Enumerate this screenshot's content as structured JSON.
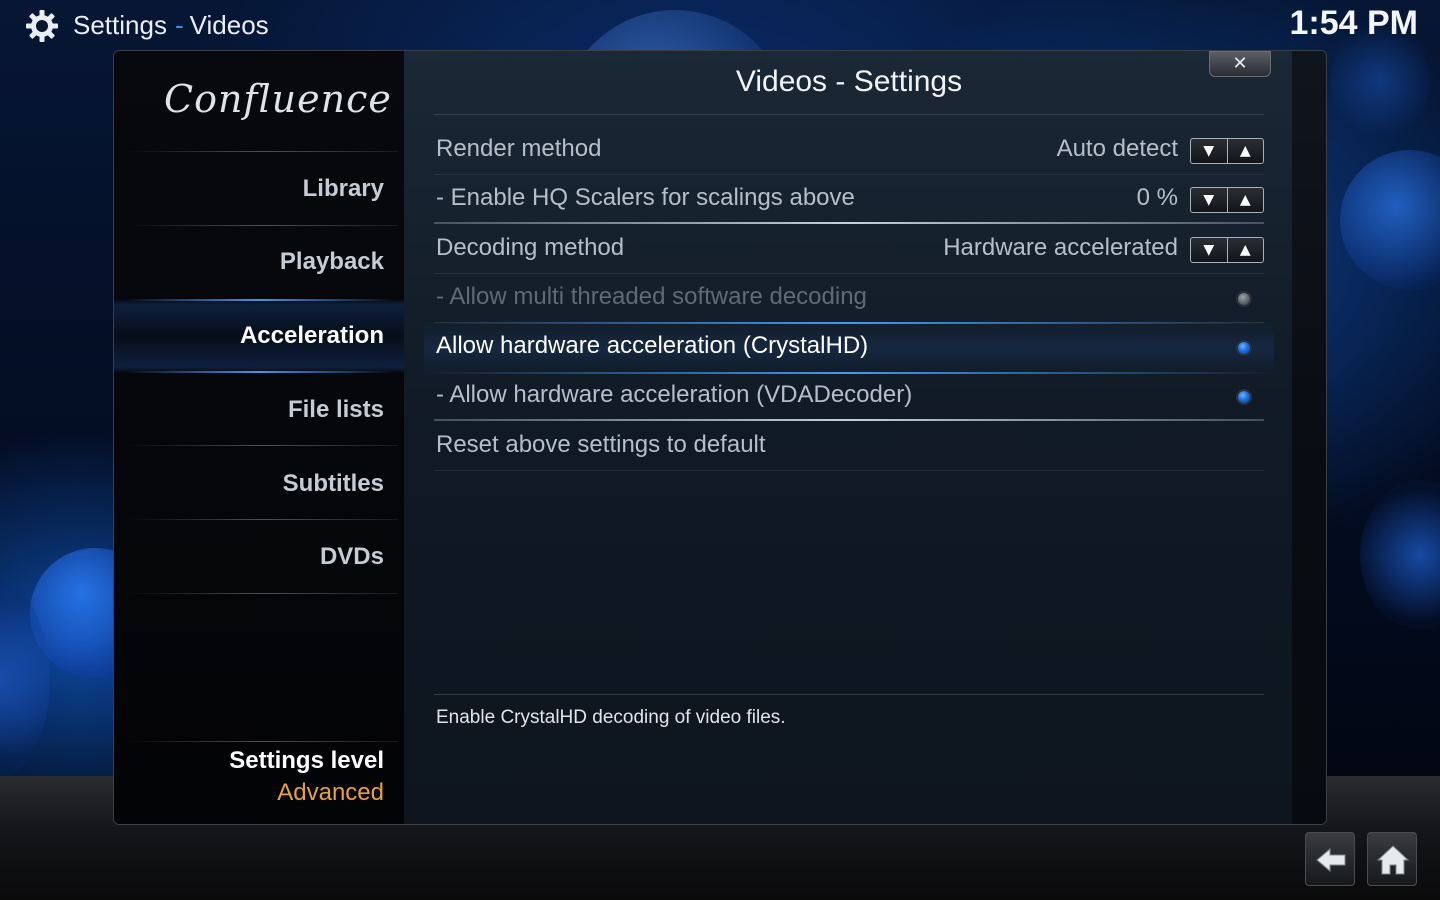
{
  "header": {
    "section": "Settings",
    "separator": "-",
    "subsection": "Videos",
    "clock": "1:54 PM",
    "icon": "gear-icon"
  },
  "dialog": {
    "title": "Videos - Settings",
    "close_label": "✕",
    "logo_text": "Confluence"
  },
  "sidebar": {
    "items": [
      {
        "label": "Library",
        "active": false
      },
      {
        "label": "Playback",
        "active": false
      },
      {
        "label": "Acceleration",
        "active": true
      },
      {
        "label": "File lists",
        "active": false
      },
      {
        "label": "Subtitles",
        "active": false
      },
      {
        "label": "DVDs",
        "active": false
      }
    ],
    "settings_level_label": "Settings level",
    "settings_level_value": "Advanced"
  },
  "settings": [
    {
      "label": "Render method",
      "type": "spinner",
      "value": "Auto detect",
      "state": "enabled"
    },
    {
      "label": "- Enable HQ Scalers for scalings above",
      "type": "spinner",
      "value": "0 %",
      "state": "enabled"
    },
    {
      "label": "Decoding method",
      "type": "spinner",
      "value": "Hardware accelerated",
      "state": "enabled"
    },
    {
      "label": "- Allow multi threaded software decoding",
      "type": "radio",
      "checked": false,
      "state": "disabled"
    },
    {
      "label": "Allow hardware acceleration (CrystalHD)",
      "type": "radio",
      "checked": true,
      "state": "focused"
    },
    {
      "label": "- Allow hardware acceleration (VDADecoder)",
      "type": "radio",
      "checked": true,
      "state": "enabled"
    },
    {
      "label": "Reset above settings to default",
      "type": "action",
      "state": "enabled"
    }
  ],
  "spinner_glyphs": {
    "down": "▼",
    "up": "▲"
  },
  "description": "Enable CrystalHD decoding of video files.",
  "bottom_nav": [
    {
      "name": "back-button",
      "icon": "back-arrow-icon"
    },
    {
      "name": "home-button",
      "icon": "home-icon"
    }
  ],
  "colors": {
    "accent": "#3b8be8",
    "level_value": "#e8a42c",
    "radio_on": "#1d6fe0"
  }
}
